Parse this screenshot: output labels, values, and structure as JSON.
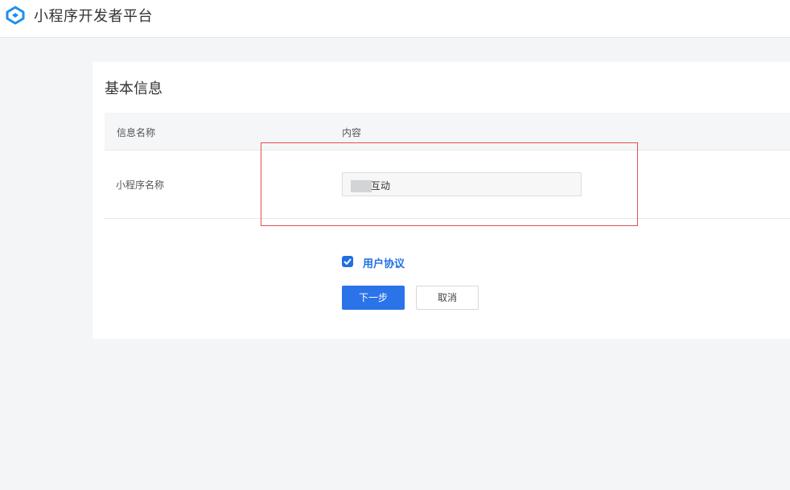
{
  "header": {
    "app_title": "小程序开发者平台",
    "logo_icon": "mini-program-logo-icon",
    "logo_color": "#1f8ff0"
  },
  "basic_info": {
    "section_title": "基本信息",
    "table": {
      "columns": [
        "信息名称",
        "内容"
      ],
      "rows": [
        {
          "label": "小程序名称",
          "value_visible_suffix": "互动",
          "value_partially_redacted": true
        }
      ]
    }
  },
  "agreement": {
    "checked": true,
    "label": "用户协议"
  },
  "actions": {
    "next_label": "下一步",
    "cancel_label": "取消"
  },
  "colors": {
    "primary": "#2a73e8",
    "highlight_border": "#e05050",
    "page_background": "#f4f5f7"
  }
}
